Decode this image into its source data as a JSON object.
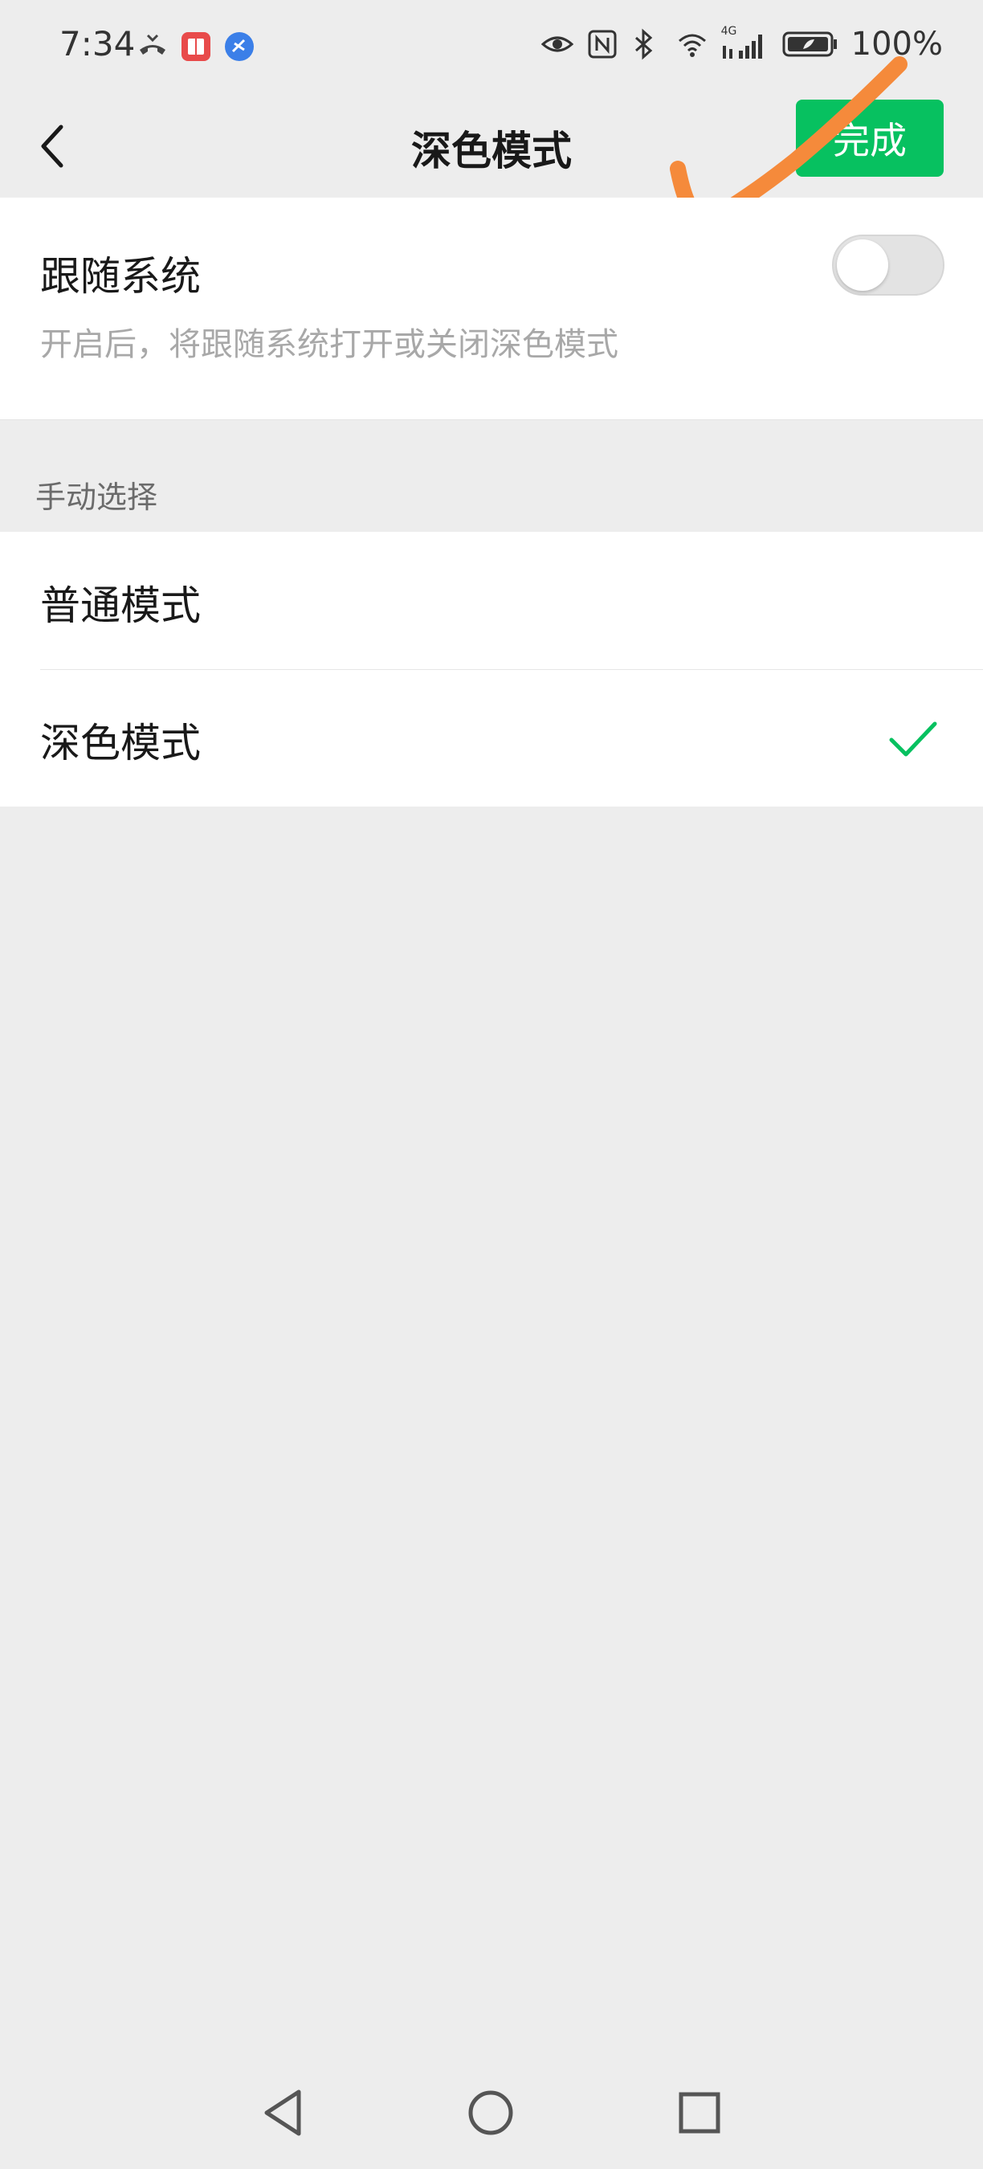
{
  "status_bar": {
    "time": "7:34",
    "battery_percent": "100%",
    "network_label": "4G",
    "left_icons": [
      "missed-call-icon",
      "book-app-icon",
      "browser-app-icon"
    ],
    "right_icons": [
      "eye-icon",
      "nfc-icon",
      "bluetooth-icon",
      "wifi-icon",
      "signal-icon",
      "battery-icon"
    ]
  },
  "nav": {
    "title": "深色模式",
    "done_label": "完成"
  },
  "follow_system": {
    "title": "跟随系统",
    "description": "开启后，将跟随系统打开或关闭深色模式",
    "enabled": false
  },
  "manual": {
    "section_label": "手动选择",
    "options": [
      {
        "label": "普通模式",
        "selected": false
      },
      {
        "label": "深色模式",
        "selected": true
      }
    ]
  },
  "colors": {
    "accent": "#07c160",
    "background": "#ededed",
    "annotation": "#f58a3b"
  }
}
